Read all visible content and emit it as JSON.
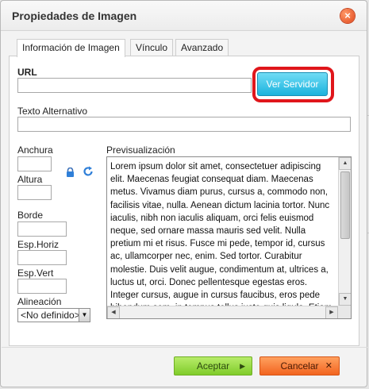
{
  "dialog": {
    "title": "Propiedades de Imagen",
    "close_icon": "close-icon",
    "close_glyph": "×"
  },
  "tabs": [
    {
      "label": "Información de Imagen",
      "active": true
    },
    {
      "label": "Vínculo",
      "active": false
    },
    {
      "label": "Avanzado",
      "active": false
    }
  ],
  "form": {
    "url_label": "URL",
    "url_value": "",
    "browse_button": "Ver Servidor",
    "alt_label": "Texto Alternativo",
    "alt_value": "",
    "width_label": "Anchura",
    "width_value": "",
    "height_label": "Altura",
    "height_value": "",
    "lock_icon": "lock-icon",
    "reset_icon": "reset-size-icon",
    "border_label": "Borde",
    "border_value": "",
    "hspace_label": "Esp.Horiz",
    "hspace_value": "",
    "vspace_label": "Esp.Vert",
    "vspace_value": "",
    "align_label": "Alineación",
    "align_selected": "<No definido>"
  },
  "preview": {
    "label": "Previsualización",
    "text": "Lorem ipsum dolor sit amet, consectetuer adipiscing elit. Maecenas feugiat consequat diam. Maecenas metus. Vivamus diam purus, cursus a, commodo non, facilisis vitae, nulla. Aenean dictum lacinia tortor. Nunc iaculis, nibh non iaculis aliquam, orci felis euismod neque, sed ornare massa mauris sed velit. Nulla pretium mi et risus. Fusce mi pede, tempor id, cursus ac, ullamcorper nec, enim. Sed tortor. Curabitur molestie. Duis velit augue, condimentum at, ultrices a, luctus ut, orci. Donec pellentesque egestas eros. Integer cursus, augue in cursus faucibus, eros pede bibendum sem, in tempus tellus justo quis ligula. Etiam eget tortor."
  },
  "footer": {
    "ok_label": "Aceptar",
    "cancel_label": "Cancelar"
  },
  "colors": {
    "browse_highlight": "#e0161b",
    "browse_button": "#1cb3dd",
    "ok_button": "#7fcc2a",
    "cancel_button": "#f2641f",
    "close_button": "#e0461a"
  }
}
